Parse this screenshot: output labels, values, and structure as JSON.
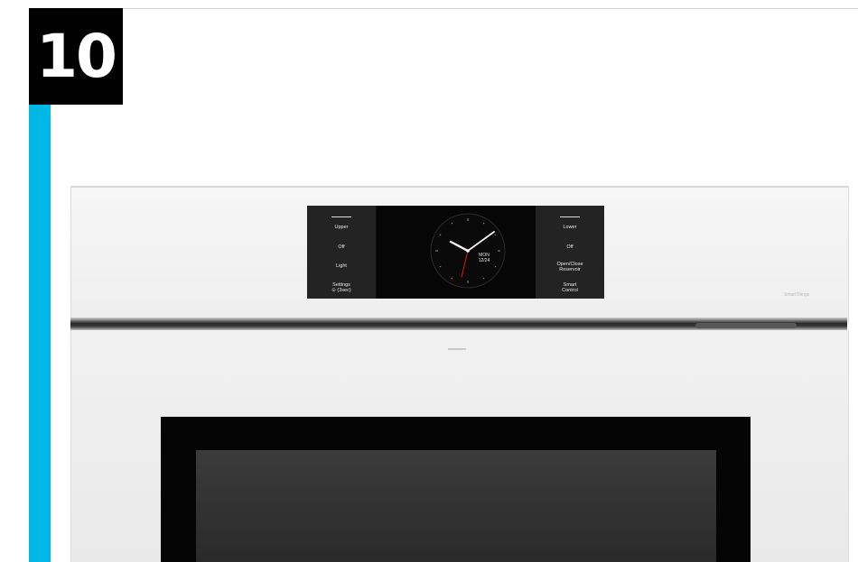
{
  "badge": {
    "number": "10"
  },
  "panel": {
    "left_buttons": [
      "Upper",
      "Off",
      "Light",
      "Settings",
      "⊙ (3sec)"
    ],
    "right_buttons": [
      "Lower",
      "Off",
      "Open/Close",
      "Reservoir",
      "Smart",
      "Control"
    ],
    "clock": {
      "day": "MON",
      "date": "12/24"
    }
  },
  "brand_text": "SmartThings",
  "colors": {
    "accent": "#00b8e6",
    "badge_bg": "#000000",
    "clock_second_hand": "#d01818"
  }
}
